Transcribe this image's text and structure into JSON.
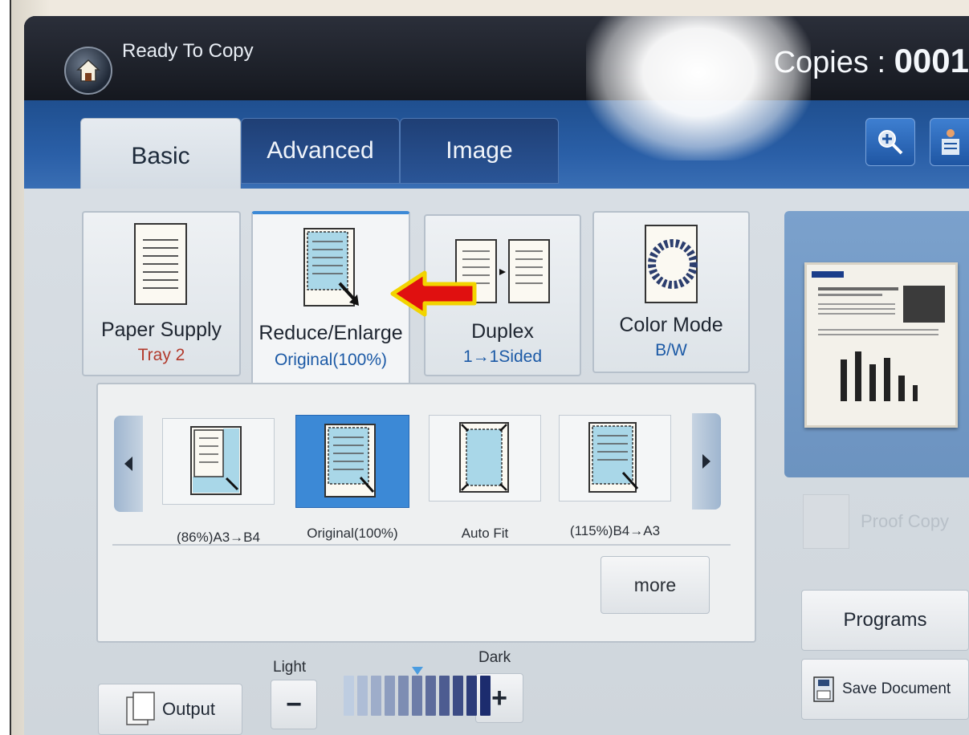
{
  "topbar": {
    "status": "Ready To Copy",
    "copies_label": "Copies : ",
    "copies_value": "0001"
  },
  "tabs": [
    {
      "label": "Basic",
      "active": true
    },
    {
      "label": "Advanced",
      "active": false
    },
    {
      "label": "Image",
      "active": false
    }
  ],
  "functions": {
    "paper_supply": {
      "label": "Paper Supply",
      "value": "Tray 2"
    },
    "reduce_enlarge": {
      "label": "Reduce/Enlarge",
      "value": "Original(100%)"
    },
    "duplex": {
      "label": "Duplex",
      "value": "1→1Sided"
    },
    "color_mode": {
      "label": "Color Mode",
      "value": "B/W"
    }
  },
  "options": [
    {
      "label": "(86%)A3→B4",
      "selected": false
    },
    {
      "label": "Original(100%)",
      "selected": true
    },
    {
      "label": "Auto Fit",
      "selected": false
    },
    {
      "label": "(115%)B4→A3",
      "selected": false
    }
  ],
  "more_label": "more",
  "density": {
    "light_label": "Light",
    "dark_label": "Dark",
    "minus": "−",
    "plus": "+",
    "level_fraction": 0.5
  },
  "side": {
    "proof_copy": "Proof Copy",
    "programs": "Programs",
    "save_document": "Save Document"
  },
  "output_label": "Output",
  "colors": {
    "selected_option": "#3c89d6",
    "tab_bar": "#2a5fa7",
    "value_text": "#1c5aa6",
    "tray_text": "#b23a2c",
    "annotation_arrow": "#e01010"
  }
}
